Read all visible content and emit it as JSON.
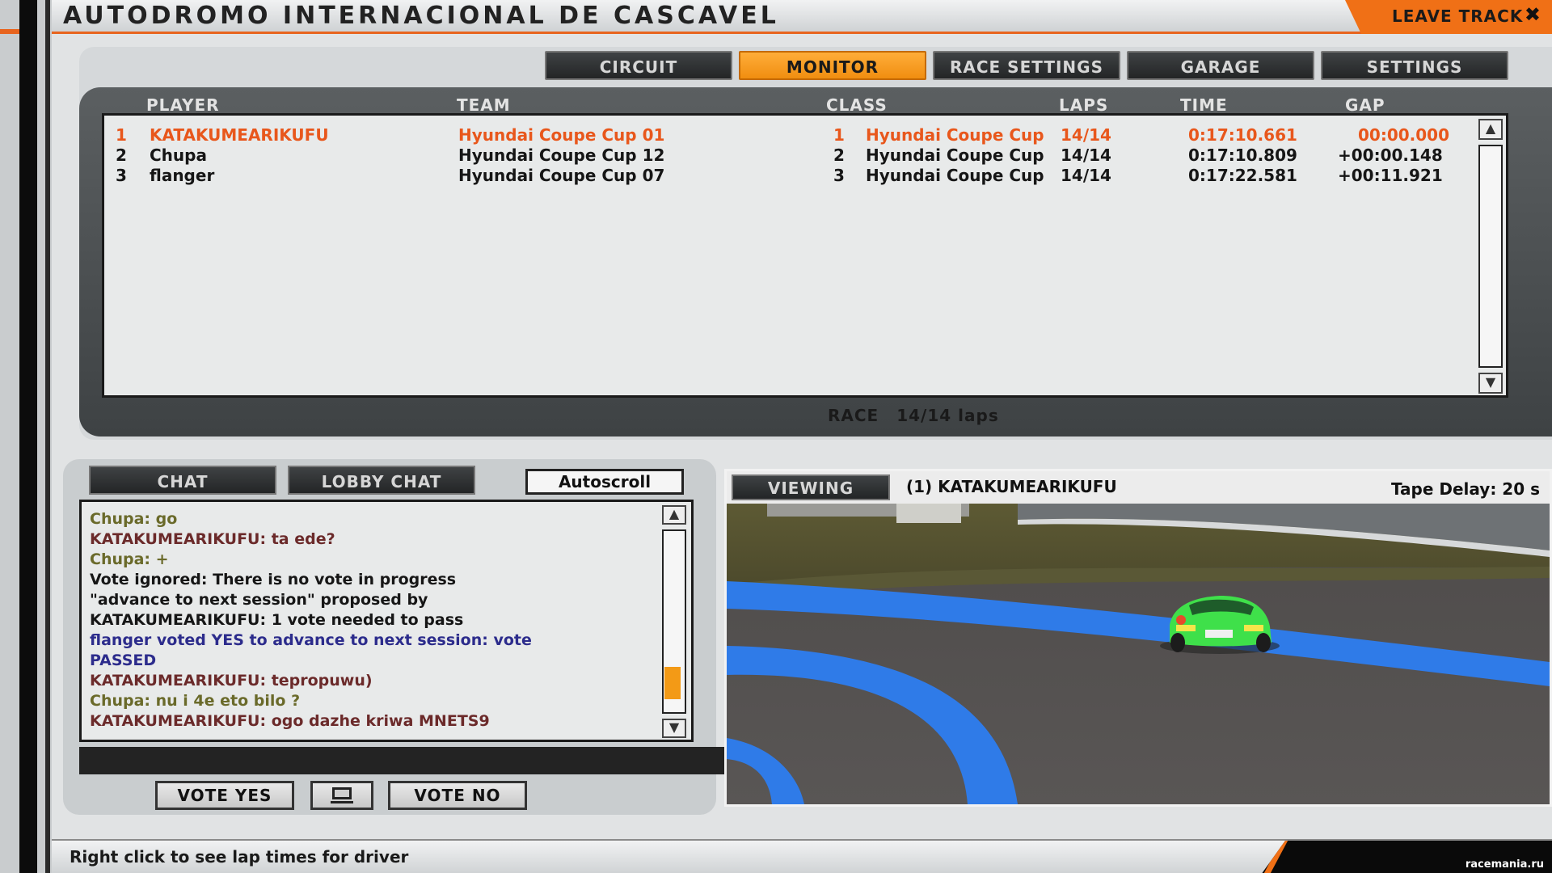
{
  "title": "AUTODROMO INTERNACIONAL DE CASCAVEL",
  "leave_track": "LEAVE TRACK",
  "tabs": [
    {
      "label": "CIRCUIT"
    },
    {
      "label": "MONITOR"
    },
    {
      "label": "RACE SETTINGS"
    },
    {
      "label": "GARAGE"
    },
    {
      "label": "SETTINGS"
    }
  ],
  "active_tab": "MONITOR",
  "monitor": {
    "headers": {
      "player": "PLAYER",
      "team": "TEAM",
      "class": "CLASS",
      "laps": "LAPS",
      "time": "TIME",
      "gap": "GAP"
    },
    "rows": [
      {
        "pos": "1",
        "player": "KATAKUMEARIKUFU",
        "team": "Hyundai Coupe Cup 01",
        "class_pos": "1",
        "class": "Hyundai Coupe Cup",
        "laps": "14/14",
        "time": "0:17:10.661",
        "gap": "00:00.000"
      },
      {
        "pos": "2",
        "player": "Chupa",
        "team": "Hyundai Coupe Cup 12",
        "class_pos": "2",
        "class": "Hyundai Coupe Cup",
        "laps": "14/14",
        "time": "0:17:10.809",
        "gap": "+00:00.148"
      },
      {
        "pos": "3",
        "player": "flanger",
        "team": "Hyundai Coupe Cup 07",
        "class_pos": "3",
        "class": "Hyundai Coupe Cup",
        "laps": "14/14",
        "time": "0:17:22.581",
        "gap": "+00:11.921"
      }
    ],
    "session": "RACE",
    "session_laps": "14/14 laps"
  },
  "chat": {
    "tab_chat": "CHAT",
    "tab_lobby": "LOBBY CHAT",
    "autoscroll": "Autoscroll",
    "lines": [
      {
        "text": "Chupa: go",
        "color": "#6a6a2a"
      },
      {
        "text": "KATAKUMEARIKUFU: ta ede?",
        "color": "#6b2a2a"
      },
      {
        "text": "Chupa: +",
        "color": "#6a6a2a"
      },
      {
        "text": "Vote ignored: There is no vote in progress",
        "color": "#161616"
      },
      {
        "text": "\"advance to next session\" proposed by",
        "color": "#161616"
      },
      {
        "text": "KATAKUMEARIKUFU: 1 vote needed to pass",
        "color": "#161616"
      },
      {
        "text": "flanger voted YES to advance to next session: vote",
        "color": "#2c2c8c"
      },
      {
        "text": "PASSED",
        "color": "#2c2c8c"
      },
      {
        "text": "KATAKUMEARIKUFU: tepropuwu)",
        "color": "#6b2a2a"
      },
      {
        "text": "Chupa: nu i 4e eto bilo ?",
        "color": "#6a6a2a"
      },
      {
        "text": "KATAKUMEARIKUFU: ogo dazhe kriwa MNETS9",
        "color": "#6b2a2a"
      }
    ],
    "scroll_position": 0.95,
    "vote_yes": "VOTE YES",
    "vote_no": "VOTE NO",
    "monitor_icon": "monitor-icon"
  },
  "viewer": {
    "button": "VIEWING",
    "driver": "(1) KATAKUMEARIKUFU",
    "tape_delay": "Tape Delay: 20 s"
  },
  "status_hint": "Right click to see lap times for driver",
  "watermark": "racemania.ru",
  "colors": {
    "accent": "#f07016",
    "leader": "#e8571c",
    "track_blue": "#2f7be8",
    "car_green": "#3fe04a"
  }
}
